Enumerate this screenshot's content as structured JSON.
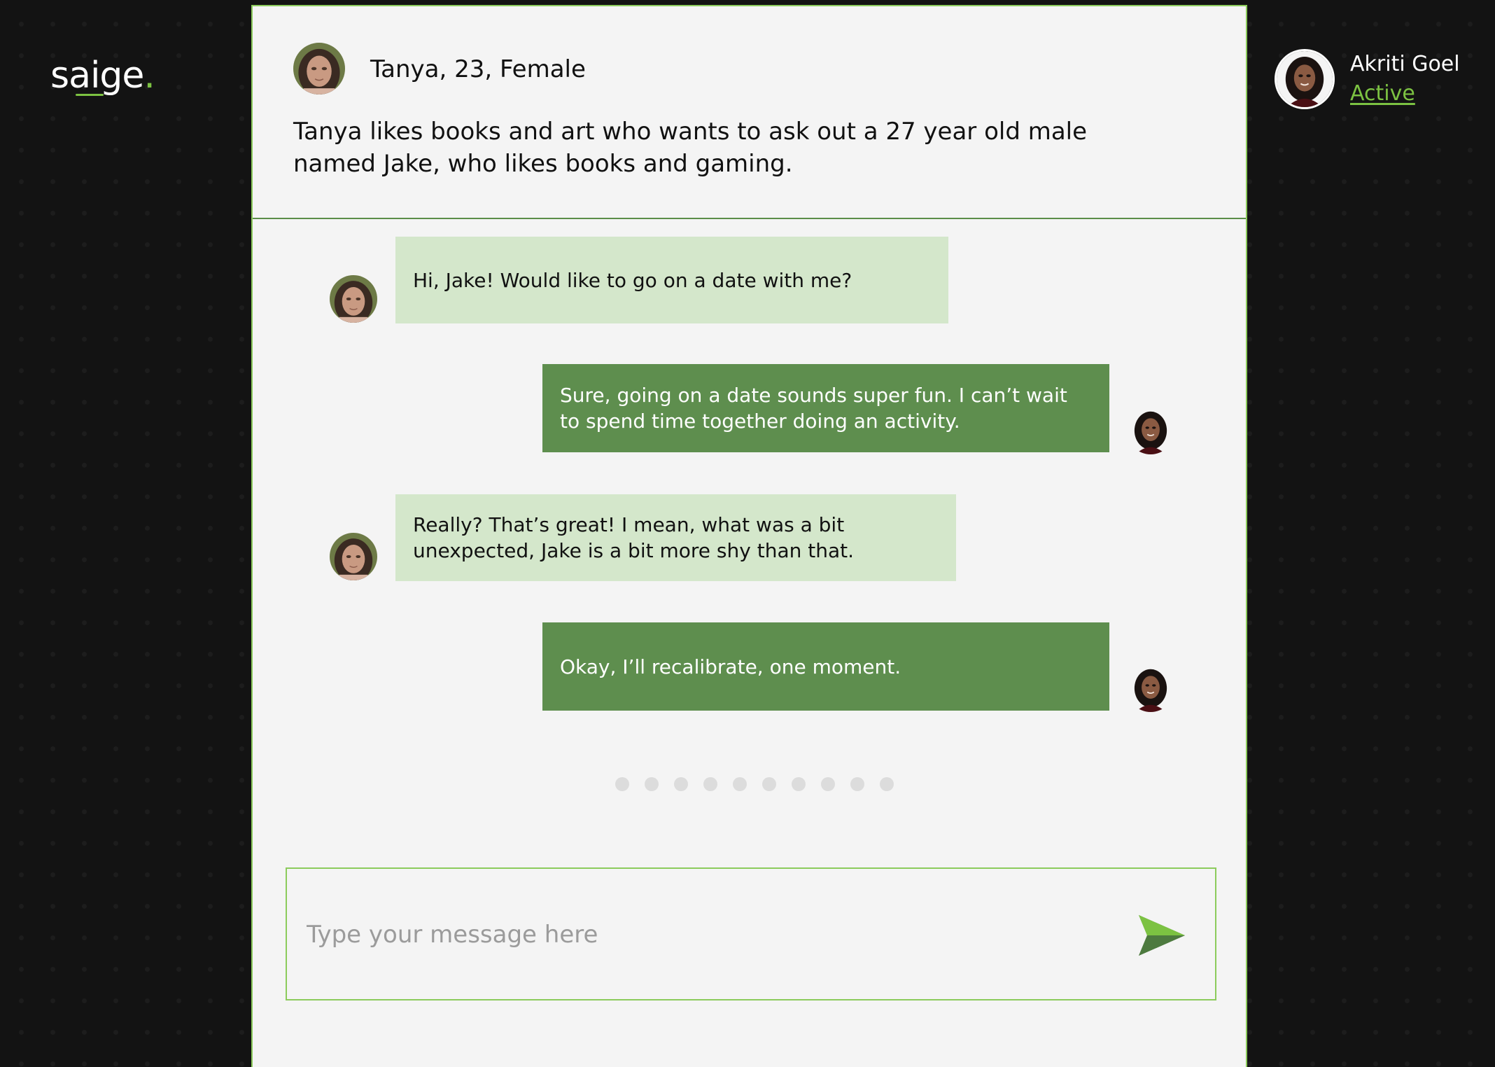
{
  "brand": {
    "logo_text": "saige",
    "logo_dot": ".",
    "accent_color": "#7cc242"
  },
  "profile": {
    "title": "Tanya, 23, Female",
    "description": "Tanya likes books and art who wants to ask out a 27 year old male named Jake, who likes books and gaming."
  },
  "user": {
    "name": "Akriti Goel",
    "status": "Active"
  },
  "messages": [
    {
      "sender": "Tanya",
      "side": "left",
      "text": "Hi, Jake! Would like to go on a date with me?"
    },
    {
      "sender": "Akriti Goel",
      "side": "right",
      "text": "Sure, going on a date sounds super fun. I can’t wait to spend time together doing an activity."
    },
    {
      "sender": "Tanya",
      "side": "left",
      "text": "Really? That’s great! I mean, what was a bit unexpected, Jake is a bit more shy than that."
    },
    {
      "sender": "Akriti Goel",
      "side": "right",
      "text": "Okay, I’ll recalibrate, one moment."
    }
  ],
  "typing_indicator": {
    "dot_count": 10
  },
  "composer": {
    "placeholder": "Type your message here",
    "value": "",
    "send_icon": "send-icon"
  },
  "colors": {
    "incoming_bubble": "#d4e7cb",
    "outgoing_bubble": "#5e8e4e",
    "panel_border": "#8ccb5c",
    "panel_bg": "#f4f4f4",
    "page_bg": "#131313"
  }
}
